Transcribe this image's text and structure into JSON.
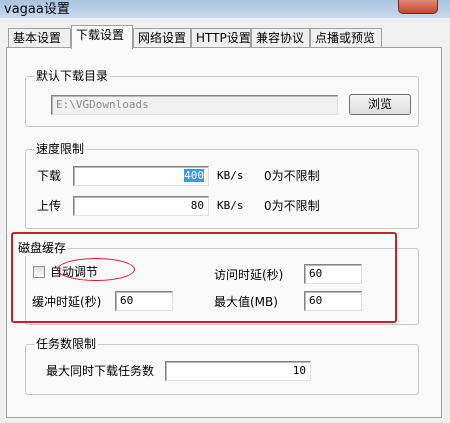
{
  "window": {
    "title": "vagaa设置"
  },
  "tabs": [
    {
      "label": "基本设置"
    },
    {
      "label": "下载设置",
      "active": true
    },
    {
      "label": "网络设置"
    },
    {
      "label": "HTTP设置"
    },
    {
      "label": "兼容协议"
    },
    {
      "label": "点播或预览"
    }
  ],
  "download_dir": {
    "legend": "默认下载目录",
    "path_value": "E:\\VGDownloads",
    "browse_label": "浏览"
  },
  "speed_limit": {
    "legend": "速度限制",
    "download_label": "下载",
    "download_value": "400",
    "upload_label": "上传",
    "upload_value": "80",
    "unit": "KB/s",
    "hint": "0为不限制"
  },
  "disk_cache": {
    "legend": "磁盘缓存",
    "auto_adjust_label": "自动调节",
    "auto_adjust_checked": false,
    "buffer_delay_label": "缓冲时延(秒)",
    "buffer_delay_value": "60",
    "access_delay_label": "访问时延(秒)",
    "access_delay_value": "60",
    "max_value_label": "最大值(MB)",
    "max_value_value": "60"
  },
  "task_limit": {
    "legend": "任务数限制",
    "max_tasks_label": "最大同时下载任务数",
    "max_tasks_value": "10"
  },
  "annotation_color": "#c8202a"
}
